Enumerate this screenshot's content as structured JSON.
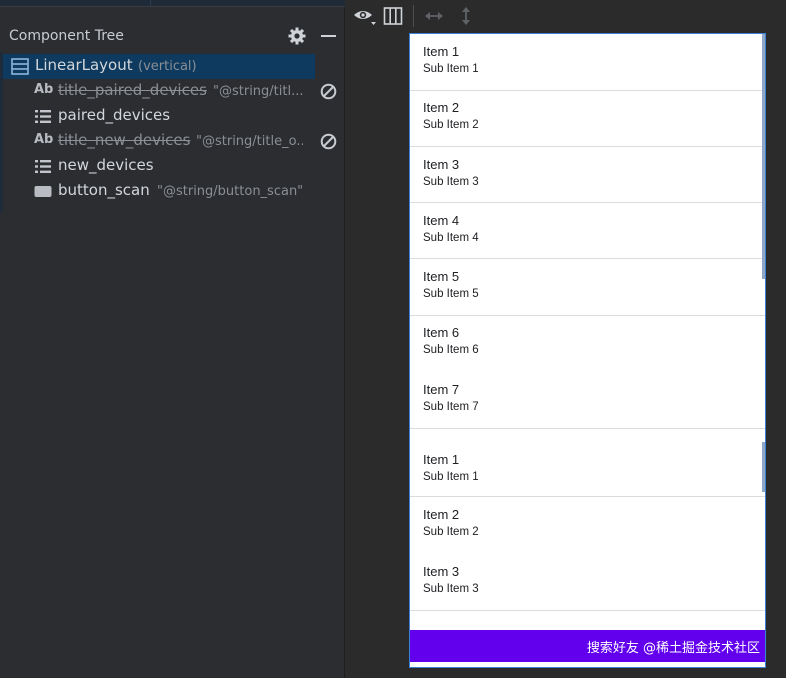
{
  "component_tree": {
    "title": "Component Tree",
    "root": {
      "label": "LinearLayout",
      "detail": "(vertical)"
    },
    "children": [
      {
        "icon": "text-view-icon",
        "icon_text": "Ab",
        "label": "title_paired_devices",
        "detail": "\"@string/titl...",
        "strikethrough": true,
        "warning": true
      },
      {
        "icon": "list-view-icon",
        "label": "paired_devices",
        "detail": "",
        "strikethrough": false,
        "warning": false
      },
      {
        "icon": "text-view-icon",
        "icon_text": "Ab",
        "label": "title_new_devices",
        "detail": "\"@string/title_o...",
        "strikethrough": true,
        "warning": true
      },
      {
        "icon": "list-view-icon",
        "label": "new_devices",
        "detail": "",
        "strikethrough": false,
        "warning": false
      },
      {
        "icon": "button-icon",
        "label": "button_scan",
        "detail": "\"@string/button_scan\"",
        "strikethrough": false,
        "warning": false
      }
    ]
  },
  "preview": {
    "list_top": [
      {
        "title": "Item 1",
        "subtitle": "Sub Item 1"
      },
      {
        "title": "Item 2",
        "subtitle": "Sub Item 2"
      },
      {
        "title": "Item 3",
        "subtitle": "Sub Item 3"
      },
      {
        "title": "Item 4",
        "subtitle": "Sub Item 4"
      },
      {
        "title": "Item 5",
        "subtitle": "Sub Item 5"
      },
      {
        "title": "Item 6",
        "subtitle": "Sub Item 6"
      },
      {
        "title": "Item 7",
        "subtitle": "Sub Item 7"
      }
    ],
    "list_bottom": [
      {
        "title": "Item 1",
        "subtitle": "Sub Item 1"
      },
      {
        "title": "Item 2",
        "subtitle": "Sub Item 2"
      },
      {
        "title": "Item 3",
        "subtitle": "Sub Item 3"
      }
    ],
    "button_label": "搜索好友 @稀土掘金技术社区",
    "button_color": "#6200ee"
  },
  "colors": {
    "selection": "#0d3a5e",
    "panel_bg": "#2b2d30",
    "canvas_bg": "#2b2b2b",
    "device_border": "#3c7fd6"
  }
}
